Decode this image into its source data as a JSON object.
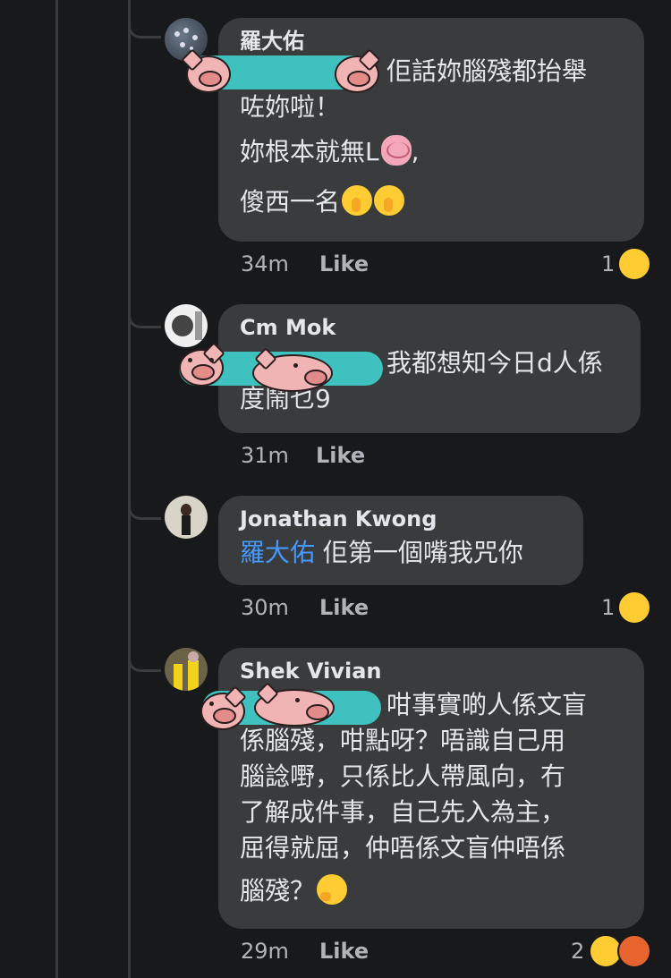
{
  "comments": [
    {
      "author": "羅大佑",
      "lines": [
        "佢話妳腦殘都抬舉",
        "咗妳啦！",
        "妳根本就無L",
        "傻西一名"
      ],
      "brain_suffix": ",",
      "time": "34m",
      "like_label": "Like",
      "reaction_count": "1",
      "reactions": [
        "haha"
      ]
    },
    {
      "author": "Cm Mok",
      "lines": [
        "我都想知今日d人係",
        "度鬧乜9"
      ],
      "time": "31m",
      "like_label": "Like"
    },
    {
      "author": "Jonathan Kwong",
      "mention": "羅大佑",
      "lines": [
        "佢第一個嘴我咒你"
      ],
      "time": "30m",
      "like_label": "Like",
      "reaction_count": "1",
      "reactions": [
        "haha"
      ]
    },
    {
      "author": "Shek Vivian",
      "lines": [
        "咁事實啲人係文盲",
        "係腦殘，咁點呀？唔識自己用",
        "腦諗嘢，只係比人帶風向，冇",
        "了解成件事，自己先入為主，",
        "屈得就屈，仲唔係文盲仲唔係",
        "腦殘？"
      ],
      "time": "29m",
      "like_label": "Like",
      "reaction_count": "2",
      "reactions": [
        "care",
        "angry"
      ]
    }
  ],
  "colors": {
    "background": "#18191a",
    "bubble": "#3a3b3c",
    "text": "#e4e6eb",
    "meta": "#b0b3b8",
    "mention": "#4599ff",
    "redaction": "#3fc1c0",
    "reaction_haha": "#ffcc33",
    "reaction_angry": "#e8642e"
  },
  "icons": [
    "avatar",
    "pig-sticker",
    "shushing-face-emoji",
    "brain-emoji",
    "thinking-face-emoji",
    "haha-reaction-icon",
    "care-reaction-icon",
    "angry-reaction-icon"
  ]
}
